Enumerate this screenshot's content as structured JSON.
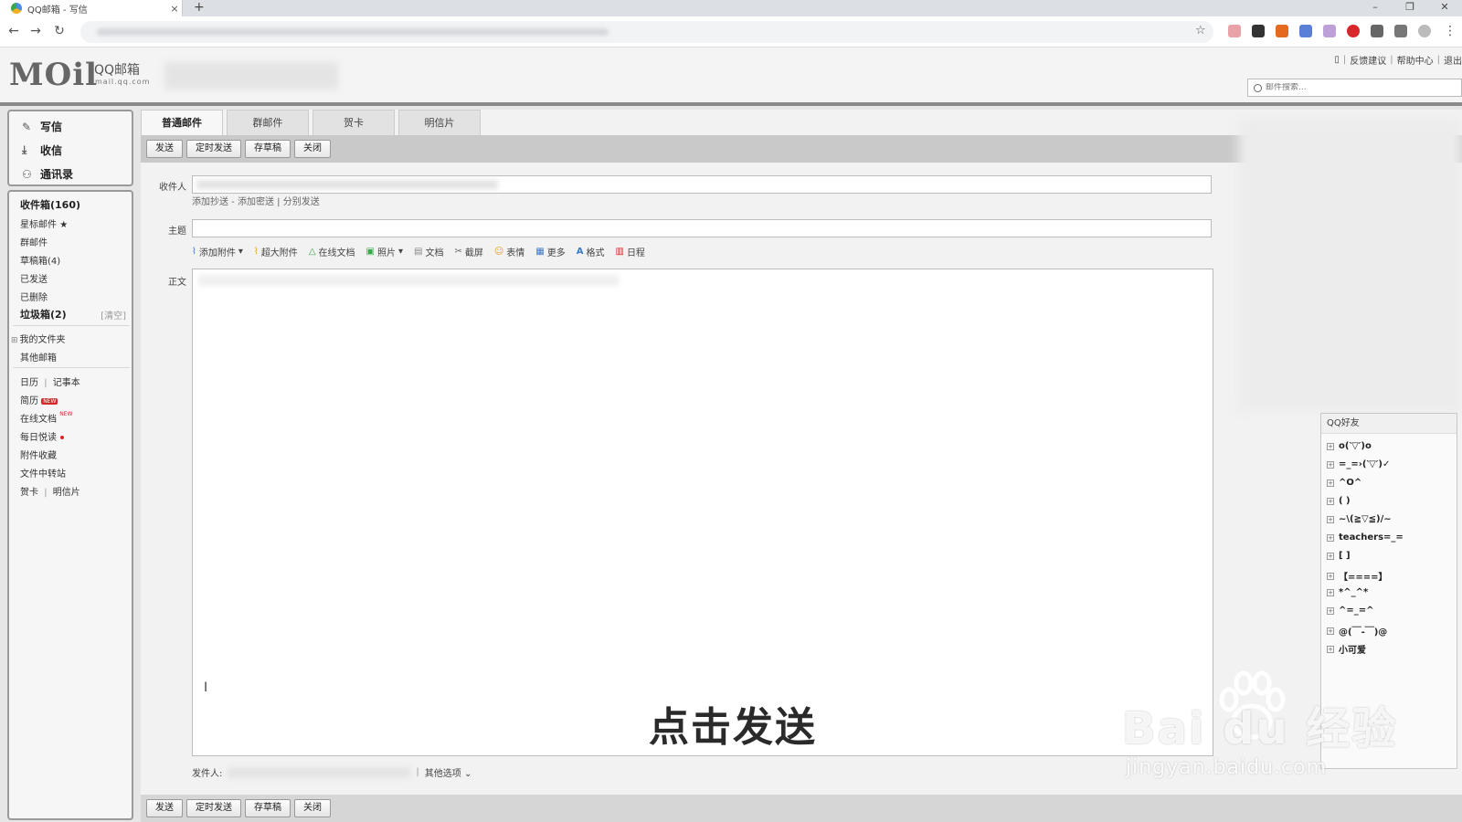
{
  "browser": {
    "tab_title": "QQ邮箱 - 写信",
    "tab_close": "×",
    "new_tab": "+",
    "win_min": "–",
    "win_max": "❐",
    "win_close": "✕"
  },
  "header": {
    "logo_text": "MOil",
    "brand": "QQ邮箱",
    "brand_sub": "mail.qq.com",
    "links": [
      "反馈建议",
      "帮助中心",
      "退出"
    ],
    "search_placeholder": "邮件搜索..."
  },
  "sidebar": {
    "actions": [
      {
        "label": "写信",
        "icon": "pen-icon"
      },
      {
        "label": "收信",
        "icon": "download-icon"
      },
      {
        "label": "通讯录",
        "icon": "contacts-icon"
      }
    ],
    "folders": {
      "inbox": "收件箱(160)",
      "starred": "星标邮件",
      "group": "群邮件",
      "drafts": "草稿箱(4)",
      "sent": "已发送",
      "deleted": "已删除",
      "spam": "垃圾箱(2)",
      "spam_clear": "[清空]",
      "my_folders": "我的文件夹",
      "other_mailbox": "其他邮箱",
      "calendar": "日历",
      "notebook": "记事本",
      "resume": "简历",
      "resume_badge": "NEW",
      "online_docs": "在线文档",
      "online_docs_badge": "NEW",
      "daily_read": "每日悦读",
      "attachment_fav": "附件收藏",
      "file_transfer": "文件中转站",
      "greeting_card": "贺卡",
      "postcard": "明信片",
      "separator": "|"
    }
  },
  "compose": {
    "tabs": [
      "普通邮件",
      "群邮件",
      "贺卡",
      "明信片"
    ],
    "buttons": {
      "send": "发送",
      "schedule": "定时发送",
      "save_draft": "存草稿",
      "close": "关闭"
    },
    "labels": {
      "to": "收件人",
      "subject": "主题",
      "body": "正文",
      "sender": "发件人:",
      "other_options": "其他选项"
    },
    "cc_links": {
      "add_cc": "添加抄送",
      "dash": " - ",
      "add_bcc": "添加密送",
      "sep": " | ",
      "separate_send": "分别发送"
    },
    "attach_bar": [
      "添加附件",
      "超大附件",
      "在线文档",
      "照片",
      "文档",
      "截屏",
      "表情",
      "更多",
      "格式",
      "日程"
    ]
  },
  "contacts": {
    "title": "QQ好友",
    "groups": [
      "o(‵▽′)o",
      "=_=›(‵▽′)✓",
      "^O^",
      "( )",
      "~\\(≧▽≦)/~",
      "teachers=_=",
      "[ ]",
      "【====】",
      "*^_^*",
      "^=_=^",
      "@(￣-￣)@",
      "小可爱"
    ]
  },
  "overlay": {
    "caption": "点击发送",
    "watermark": "Bai du 经验",
    "watermark_sub": "jingyan.baidu.com"
  }
}
